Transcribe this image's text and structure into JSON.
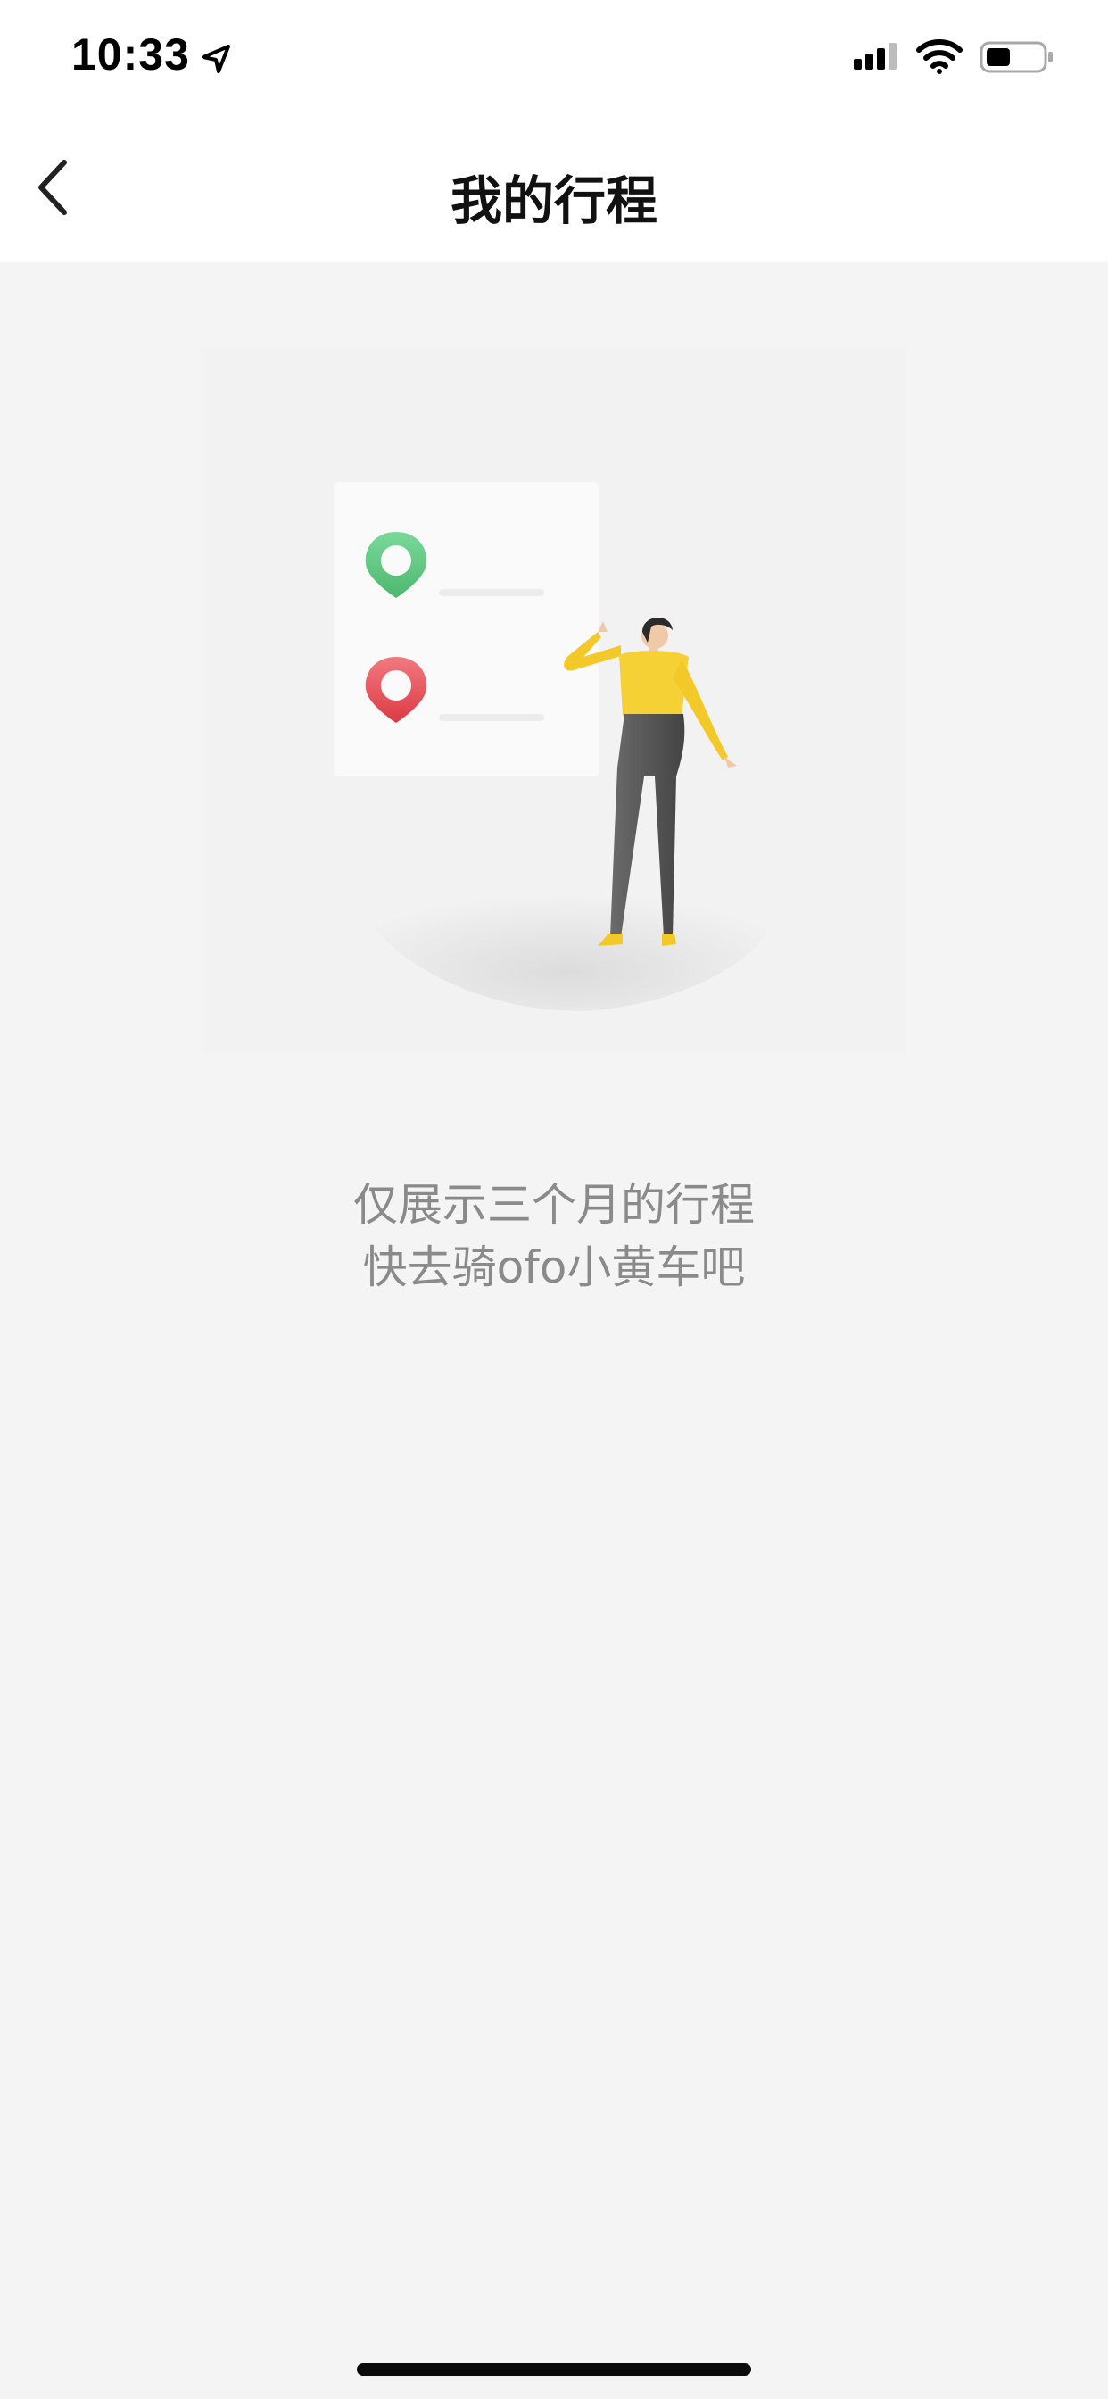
{
  "status_bar": {
    "time": "10:33",
    "icons": [
      "location-arrow-icon",
      "cellular-signal-icon",
      "wifi-icon",
      "battery-icon"
    ],
    "battery_level": 0.4
  },
  "nav": {
    "title": "我的行程",
    "back_icon": "chevron-left-icon"
  },
  "empty_state": {
    "line1": "仅展示三个月的行程",
    "line2": "快去骑ofo小黄车吧",
    "illustration": {
      "icons": [
        "map-pin-green-icon",
        "map-pin-red-icon"
      ],
      "colors": {
        "start_pin": "#5fc77d",
        "end_pin": "#e84c55",
        "shirt": "#f6d136",
        "pants": "#5e5e5e"
      }
    }
  },
  "theme": {
    "background": "#f4f4f4",
    "bar_background": "#ffffff",
    "text_muted": "#8a8a8a"
  }
}
